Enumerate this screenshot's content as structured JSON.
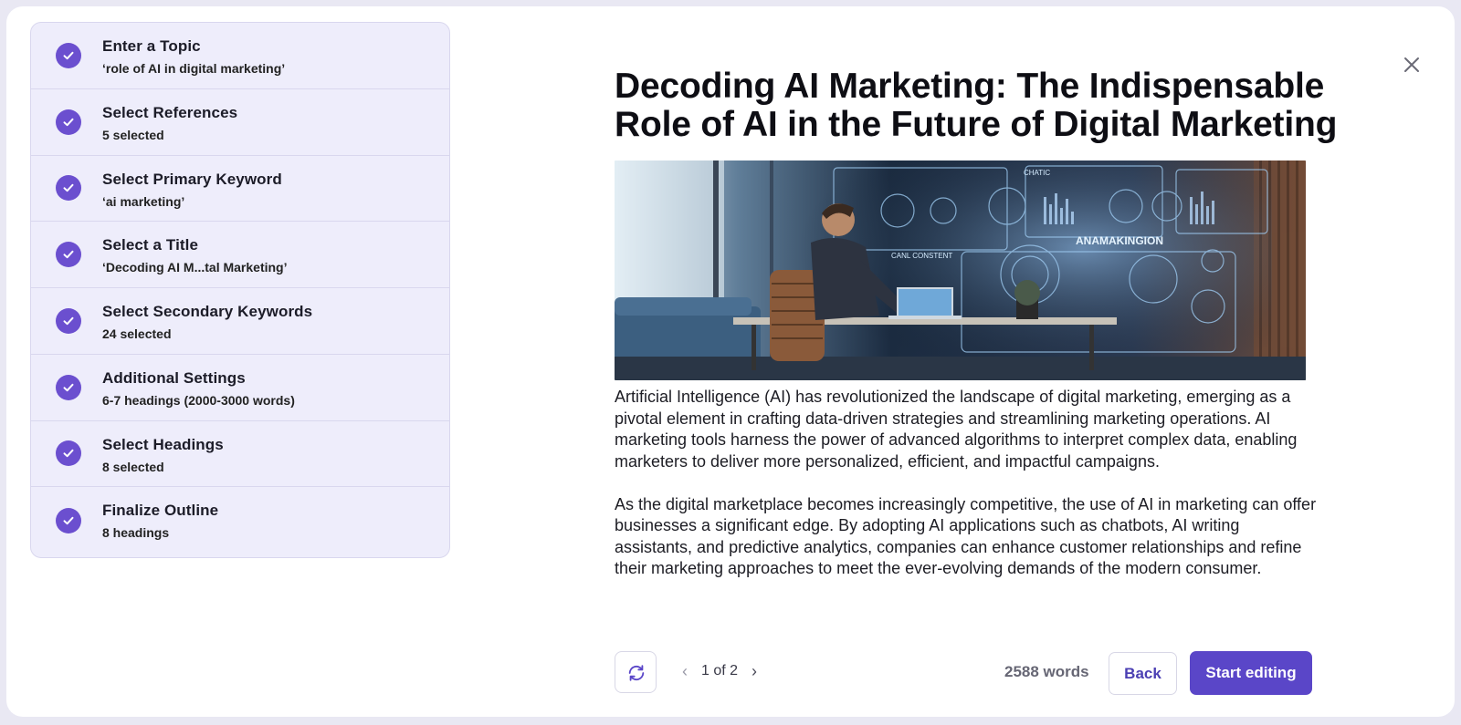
{
  "steps": [
    {
      "title": "Enter a Topic",
      "subtitle": "‘role of AI in digital marketing’"
    },
    {
      "title": "Select References",
      "subtitle": "5 selected"
    },
    {
      "title": "Select Primary Keyword",
      "subtitle": "‘ai marketing’"
    },
    {
      "title": "Select a Title",
      "subtitle": "‘Decoding AI M...tal Marketing’"
    },
    {
      "title": "Select Secondary Keywords",
      "subtitle": "24 selected"
    },
    {
      "title": "Additional Settings",
      "subtitle": "6-7 headings (2000-3000 words)"
    },
    {
      "title": "Select Headings",
      "subtitle": "8 selected"
    },
    {
      "title": "Finalize Outline",
      "subtitle": "8 headings"
    }
  ],
  "article": {
    "title": "Decoding AI Marketing: The Indispensable Role of AI in the Future of Digital Marketing",
    "paragraphs": [
      "Artificial Intelligence (AI) has revolutionized the landscape of digital marketing, emerging as a pivotal element in crafting data-driven strategies and streamlining marketing operations. AI marketing tools harness the power of advanced algorithms to interpret complex data, enabling marketers to deliver more personalized, efficient, and impactful campaigns.",
      "As the digital marketplace becomes increasingly competitive, the use of AI in marketing can offer businesses a significant edge. By adopting AI applications such as chatbots, AI writing assistants, and predictive analytics, companies can enhance customer relationships and refine their marketing approaches to meet the ever-evolving demands of the modern consumer."
    ],
    "image_labels": [
      "CHATIC",
      "CANL CONSTENT",
      "ANAMAKINGION"
    ]
  },
  "footer": {
    "page_indicator": "1 of 2",
    "word_count": "2588 words",
    "back_label": "Back",
    "start_label": "Start editing"
  },
  "colors": {
    "accent": "#5a46c8",
    "check": "#6b4fcf",
    "panel_bg": "#eeedfb"
  },
  "icons": {
    "step": "check-circle-icon",
    "close": "close-icon",
    "refresh": "refresh-icon",
    "prev": "chevron-left-icon",
    "next": "chevron-right-icon"
  }
}
